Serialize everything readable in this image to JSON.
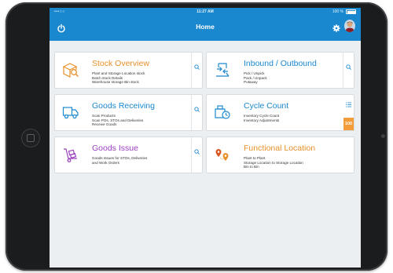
{
  "status_bar": {
    "carrier": "•••○○",
    "time": "11:27 AM",
    "battery": "100 %"
  },
  "header": {
    "title": "Home"
  },
  "tiles": [
    {
      "title": "Stock Overview",
      "color": "#e8902a",
      "lines": [
        "Plant and Storage Location stock",
        "Batch stock Details",
        "Warehouse storage Bin stock"
      ],
      "action": "search"
    },
    {
      "title": "Inbound / Outbound",
      "color": "#1a88cf",
      "lines": [
        "Pick / Unpick",
        "Pack / Unpack",
        "Putaway"
      ],
      "action": "search"
    },
    {
      "title": "Goods Receiving",
      "color": "#1a88cf",
      "lines": [
        "Scan Products",
        "Scan POs, STOs and Deliveries",
        "Receive Goods"
      ],
      "action": "search"
    },
    {
      "title": "Cycle Count",
      "color": "#1a88cf",
      "lines": [
        "Inventory Cycle Count",
        "Inventory Adjustments"
      ],
      "action": "list",
      "badge": "100"
    },
    {
      "title": "Goods Issue",
      "color": "#9b3fc0",
      "lines": [
        "Goods Issues for STOs, Deliveries",
        "and Work Orders"
      ],
      "action": "search"
    },
    {
      "title": "Functional Location",
      "color": "#e8902a",
      "lines": [
        "Plant to Plant",
        "Storage Location to Storage Location",
        "Bin to Bin"
      ],
      "action": "none"
    }
  ],
  "icons": {
    "stock": "box-search-icon",
    "inbound": "inbound-outbound-icon",
    "receiving": "delivery-truck-icon",
    "cycle": "cycle-count-icon",
    "issue": "hand-truck-icon",
    "location": "location-pins-icon"
  }
}
